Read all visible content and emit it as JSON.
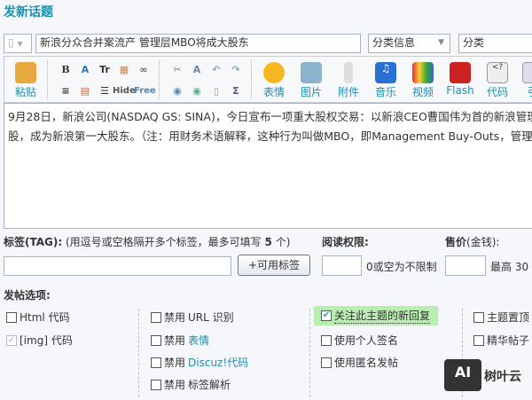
{
  "page_title": "发新话题",
  "subject": {
    "value": "新浪分众合并案流产 管理层MBO将成大股东"
  },
  "category_select": {
    "value": "分类信息"
  },
  "type_select": {
    "value": "分类"
  },
  "toolbar": {
    "paste": "粘贴",
    "bold": "B",
    "hide": "Hide",
    "free": "Free",
    "items": [
      {
        "label": "表情",
        "icon": "smiley-icon"
      },
      {
        "label": "图片",
        "icon": "image-icon"
      },
      {
        "label": "附件",
        "icon": "paperclip-icon"
      },
      {
        "label": "音乐",
        "icon": "music-icon"
      },
      {
        "label": "视频",
        "icon": "video-icon"
      },
      {
        "label": "Flash",
        "icon": "flash-icon"
      },
      {
        "label": "代码",
        "icon": "code-icon"
      },
      {
        "label": "引",
        "icon": "quote-icon"
      }
    ]
  },
  "editor": {
    "lines": [
      "9月28日，新浪公司(NASDAQ GS: SINA)，今日宣布一项重大股权交易：以新浪CEO曹国伟为首的新浪管理层",
      "股，成为新浪第一大股东。（注：用财务术语解释，这种行为叫做MBO，即Management Buy-Outs，管理层"
    ]
  },
  "tags": {
    "label": "标签(TAG):",
    "hint": "(用逗号或空格隔开多个标签，最多可填写",
    "count": "5",
    "unit": "个)",
    "value": "",
    "button": "+可用标签"
  },
  "read_perm": {
    "label": "阅读权限:",
    "value": "",
    "hint": "0或空为不限制"
  },
  "price": {
    "label": "售价",
    "label_suffix": "(金钱):",
    "value": "",
    "hint": "最高 30"
  },
  "options": {
    "label": "发帖选项:",
    "col1": [
      {
        "label": "Html 代码",
        "checked": false
      },
      {
        "label": "[img] 代码",
        "checked": true,
        "disabled": true
      }
    ],
    "col2": [
      {
        "prefix": "禁用",
        "label": "URL 识别"
      },
      {
        "prefix": "禁用",
        "label": "表情",
        "link": true
      },
      {
        "prefix": "禁用",
        "label": "Discuz!代码",
        "link": true
      },
      {
        "prefix": "禁用",
        "label": "标签解析"
      }
    ],
    "col3": [
      {
        "label": "关注此主题的新回复",
        "checked": true
      },
      {
        "label": "使用个人签名"
      },
      {
        "label": "使用匿名发帖"
      }
    ],
    "col4": [
      {
        "label": "主题置顶"
      },
      {
        "label": "精华帖子"
      }
    ]
  },
  "watermark": {
    "text": "树叶云",
    "logo": "AI"
  }
}
